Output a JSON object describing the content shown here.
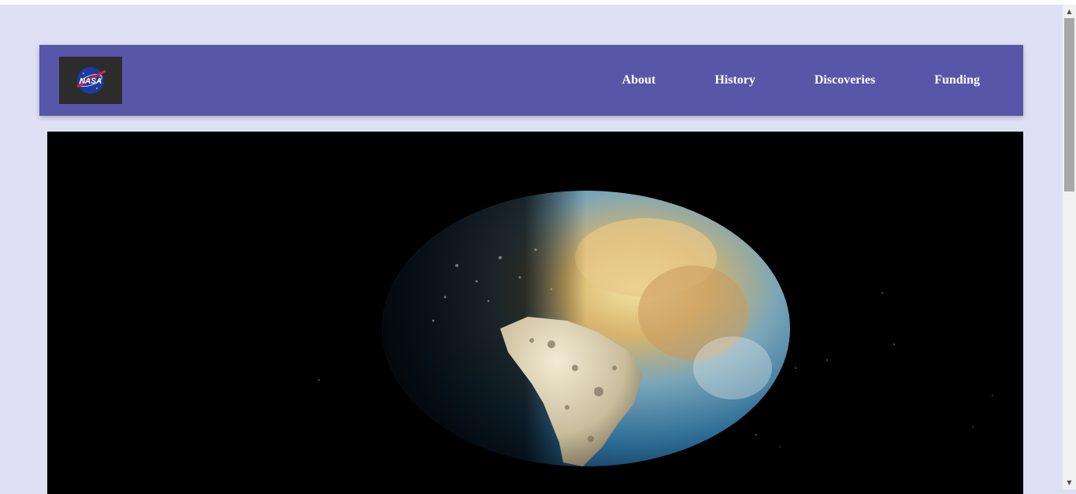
{
  "navbar": {
    "logo_text": "NASA",
    "links": [
      "About",
      "History",
      "Discoveries",
      "Funding"
    ]
  },
  "hero": {
    "image": "earth-asteroid-image"
  },
  "colors": {
    "page_background": "#e0e0f5",
    "navbar_background": "#5756a8",
    "nav_text": "#ffffff",
    "hero_background": "#000000"
  }
}
